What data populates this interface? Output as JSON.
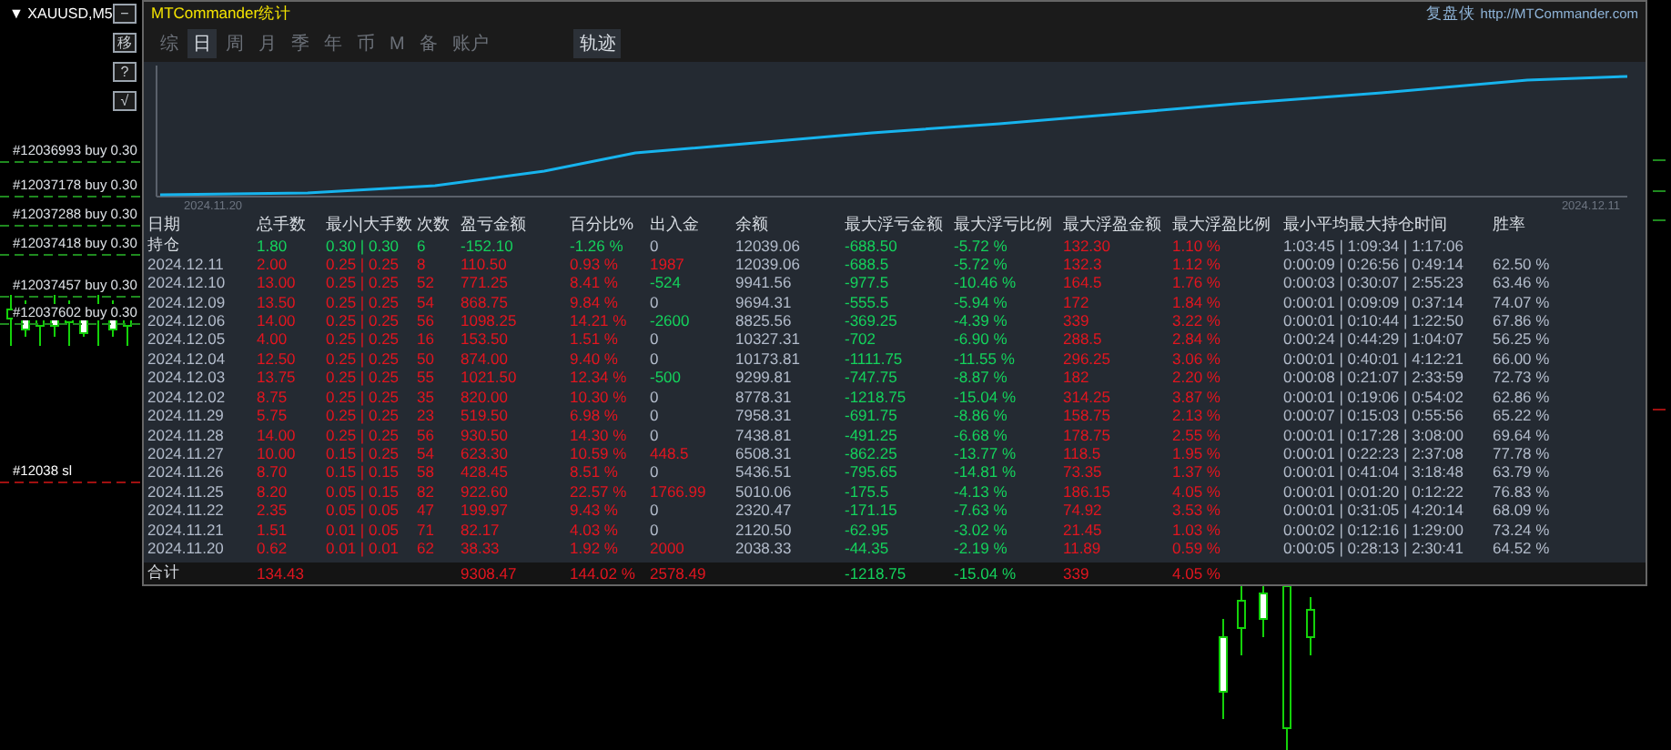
{
  "sidebar": {
    "marker": "▼",
    "symbol": "XAUUSD,M5",
    "buttons": [
      "−",
      "移",
      "?",
      "√"
    ]
  },
  "orders": [
    {
      "label": "#12036993 buy 0.30",
      "kind": "buy"
    },
    {
      "label": "#12037178 buy 0.30",
      "kind": "buy"
    },
    {
      "label": "#12037288 buy 0.30",
      "kind": "buy"
    },
    {
      "label": "#12037418 buy 0.30",
      "kind": "buy"
    },
    {
      "label": "#12037457 buy 0.30",
      "kind": "buy"
    },
    {
      "label": "#12037602 buy 0.30",
      "kind": "buy"
    },
    {
      "label": "#12038 sl",
      "kind": "sl"
    }
  ],
  "panel": {
    "title": "MTCommander统计",
    "brand": "复盘侠",
    "url": "http://MTCommander.com",
    "tabs": [
      {
        "label": "综",
        "selected": false
      },
      {
        "label": "日",
        "selected": true
      },
      {
        "label": "周",
        "selected": false
      },
      {
        "label": "月",
        "selected": false
      },
      {
        "label": "季",
        "selected": false
      },
      {
        "label": "年",
        "selected": false
      },
      {
        "label": "币",
        "selected": false
      },
      {
        "label": "M",
        "selected": false
      },
      {
        "label": "备",
        "selected": false
      },
      {
        "label": "账户",
        "selected": false
      }
    ],
    "track_tab": {
      "label": "轨迹",
      "selected": true
    },
    "chart": {
      "x_start": "2024.11.20",
      "x_end": "2024.12.11"
    },
    "table": {
      "columns": [
        "日期",
        "总手数",
        "最小|大手数",
        "次数",
        "盈亏金额",
        "百分比%",
        "出入金",
        "余额",
        "最大浮亏金额",
        "最大浮亏比例",
        "最大浮盈金额",
        "最大浮盈比例",
        "最小平均最大持仓时间",
        "胜率"
      ],
      "rows": [
        {
          "kind": "open",
          "color": "#b3bccb",
          "cells": [
            "持仓",
            "1.80",
            "0.30 | 0.30",
            "6",
            "-152.10",
            "-1.26 %",
            "0",
            "12039.06",
            "-688.50",
            "-5.72 %",
            "132.30",
            "1.10 %",
            "1:03:45 | 1:09:34 | 1:17:06",
            null
          ]
        },
        {
          "kind": "day",
          "color": "#e3151f",
          "cells": [
            "2024.12.11",
            "2.00",
            "0.25 | 0.25",
            "8",
            "110.50",
            "0.93 %",
            "1987",
            "12039.06",
            "-688.5",
            "-5.72 %",
            "132.3",
            "1.12 %",
            "0:00:09 | 0:26:56 | 0:49:14",
            "62.50 %"
          ]
        },
        {
          "kind": "day",
          "color": "#14d25c",
          "cells": [
            "2024.12.10",
            "13.00",
            "0.25 | 0.25",
            "52",
            "771.25",
            "8.41 %",
            "-524",
            "9941.56",
            "-977.5",
            "-10.46 %",
            "164.5",
            "1.76 %",
            "0:00:03 | 0:30:07 | 2:55:23",
            "63.46 %"
          ]
        },
        {
          "kind": "day",
          "color": "#b3bccb",
          "cells": [
            "2024.12.09",
            "13.50",
            "0.25 | 0.25",
            "54",
            "868.75",
            "9.84 %",
            "0",
            "9694.31",
            "-555.5",
            "-5.94 %",
            "172",
            "1.84 %",
            "0:00:01 | 0:09:09 | 0:37:14",
            "74.07 %"
          ]
        },
        {
          "kind": "day",
          "color": "#14d25c",
          "cells": [
            "2024.12.06",
            "14.00",
            "0.25 | 0.25",
            "56",
            "1098.25",
            "14.21 %",
            "-2600",
            "8825.56",
            "-369.25",
            "-4.39 %",
            "339",
            "3.22 %",
            "0:00:01 | 0:10:44 | 1:22:50",
            "67.86 %"
          ]
        },
        {
          "kind": "day",
          "color": "#b3bccb",
          "cells": [
            "2024.12.05",
            "4.00",
            "0.25 | 0.25",
            "16",
            "153.50",
            "1.51 %",
            "0",
            "10327.31",
            "-702",
            "-6.90 %",
            "288.5",
            "2.84 %",
            "0:00:24 | 0:44:29 | 1:04:07",
            "56.25 %"
          ]
        },
        {
          "kind": "day",
          "color": "#b3bccb",
          "cells": [
            "2024.12.04",
            "12.50",
            "0.25 | 0.25",
            "50",
            "874.00",
            "9.40 %",
            "0",
            "10173.81",
            "-1111.75",
            "-11.55 %",
            "296.25",
            "3.06 %",
            "0:00:01 | 0:40:01 | 4:12:21",
            "66.00 %"
          ]
        },
        {
          "kind": "day",
          "color": "#14d25c",
          "cells": [
            "2024.12.03",
            "13.75",
            "0.25 | 0.25",
            "55",
            "1021.50",
            "12.34 %",
            "-500",
            "9299.81",
            "-747.75",
            "-8.87 %",
            "182",
            "2.20 %",
            "0:00:08 | 0:21:07 | 2:33:59",
            "72.73 %"
          ]
        },
        {
          "kind": "day",
          "color": "#b3bccb",
          "cells": [
            "2024.12.02",
            "8.75",
            "0.25 | 0.25",
            "35",
            "820.00",
            "10.30 %",
            "0",
            "8778.31",
            "-1218.75",
            "-15.04 %",
            "314.25",
            "3.87 %",
            "0:00:01 | 0:19:06 | 0:54:02",
            "62.86 %"
          ]
        },
        {
          "kind": "day",
          "color": "#b3bccb",
          "cells": [
            "2024.11.29",
            "5.75",
            "0.25 | 0.25",
            "23",
            "519.50",
            "6.98 %",
            "0",
            "7958.31",
            "-691.75",
            "-8.86 %",
            "158.75",
            "2.13 %",
            "0:00:07 | 0:15:03 | 0:55:56",
            "65.22 %"
          ]
        },
        {
          "kind": "day",
          "color": "#b3bccb",
          "cells": [
            "2024.11.28",
            "14.00",
            "0.25 | 0.25",
            "56",
            "930.50",
            "14.30 %",
            "0",
            "7438.81",
            "-491.25",
            "-6.68 %",
            "178.75",
            "2.55 %",
            "0:00:01 | 0:17:28 | 3:08:00",
            "69.64 %"
          ]
        },
        {
          "kind": "day",
          "color": "#e3151f",
          "cells": [
            "2024.11.27",
            "10.00",
            "0.15 | 0.25",
            "54",
            "623.30",
            "10.59 %",
            "448.5",
            "6508.31",
            "-862.25",
            "-13.77 %",
            "118.5",
            "1.95 %",
            "0:00:01 | 0:22:23 | 2:37:08",
            "77.78 %"
          ]
        },
        {
          "kind": "day",
          "color": "#b3bccb",
          "cells": [
            "2024.11.26",
            "8.70",
            "0.15 | 0.15",
            "58",
            "428.45",
            "8.51 %",
            "0",
            "5436.51",
            "-795.65",
            "-14.81 %",
            "73.35",
            "1.37 %",
            "0:00:01 | 0:41:04 | 3:18:48",
            "63.79 %"
          ]
        },
        {
          "kind": "day",
          "color": "#e3151f",
          "cells": [
            "2024.11.25",
            "8.20",
            "0.05 | 0.15",
            "82",
            "922.60",
            "22.57 %",
            "1766.99",
            "5010.06",
            "-175.5",
            "-4.13 %",
            "186.15",
            "4.05 %",
            "0:00:01 | 0:01:20 | 0:12:22",
            "76.83 %"
          ]
        },
        {
          "kind": "day",
          "color": "#b3bccb",
          "cells": [
            "2024.11.22",
            "2.35",
            "0.05 | 0.05",
            "47",
            "199.97",
            "9.43 %",
            "0",
            "2320.47",
            "-171.15",
            "-7.63 %",
            "74.92",
            "3.53 %",
            "0:00:01 | 0:31:05 | 4:20:14",
            "68.09 %"
          ]
        },
        {
          "kind": "day",
          "color": "#b3bccb",
          "cells": [
            "2024.11.21",
            "1.51",
            "0.01 | 0.05",
            "71",
            "82.17",
            "4.03 %",
            "0",
            "2120.50",
            "-62.95",
            "-3.02 %",
            "21.45",
            "1.03 %",
            "0:00:02 | 0:12:16 | 1:29:00",
            "73.24 %"
          ]
        },
        {
          "kind": "day",
          "color": "#e3151f",
          "cells": [
            "2024.11.20",
            "0.62",
            "0.01 | 0.01",
            "62",
            "38.33",
            "1.92 %",
            "2000",
            "2038.33",
            "-44.35",
            "-2.19 %",
            "11.89",
            "0.59 %",
            "0:00:05 | 0:28:13 | 2:30:41",
            "64.52 %"
          ]
        },
        {
          "kind": "total",
          "color": "#e3151f",
          "cells": [
            "合计",
            "134.43",
            null,
            null,
            "9308.47",
            "144.02 %",
            "2578.49",
            null,
            "-1218.75",
            "-15.04 %",
            "339",
            "4.05 %",
            null,
            null
          ]
        }
      ]
    }
  }
}
